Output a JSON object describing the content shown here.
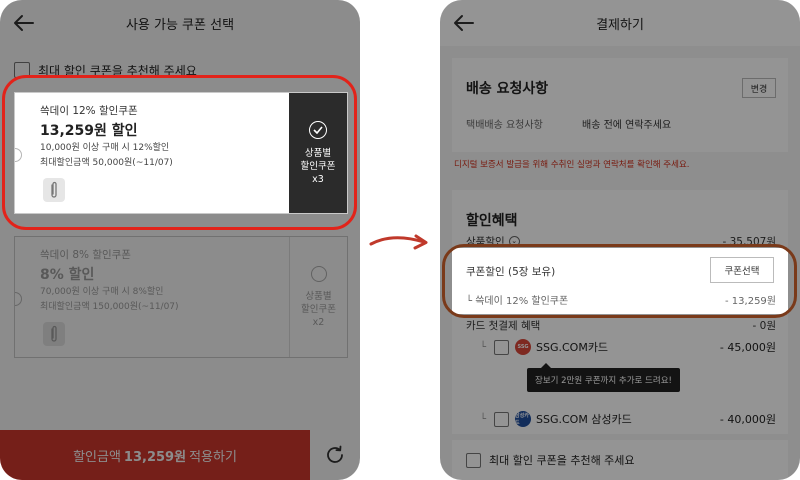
{
  "left": {
    "title": "사용 가능 쿠폰 선택",
    "recommend_label": "최대 할인 쿠폰을 추천해 주세요",
    "coupons": [
      {
        "name": "쓱데이 12% 할인쿠폰",
        "amount": "13,259원 할인",
        "cond1": "10,000원 이상 구매 시 12%할인",
        "cond2": "최대할인금액 50,000원(~11/07)",
        "side": "상품별\n할인쿠폰\nx3",
        "selected": true
      },
      {
        "name": "쓱데이 8% 할인쿠폰",
        "amount": "8% 할인",
        "cond1": "70,000원 이상 구매 시 8%할인",
        "cond2": "최대할인금액 150,000원(~11/07)",
        "side": "상품별\n할인쿠폰\nx2",
        "selected": false
      }
    ],
    "apply_prefix": "할인금액",
    "apply_amount": "13,259원",
    "apply_suffix": "적용하기"
  },
  "right": {
    "title": "결제하기",
    "shipping": {
      "title": "배송 요청사항",
      "change": "변경",
      "label": "택배배송 요청사항",
      "value": "배송 전에 연락주세요"
    },
    "notice": "디지털 보증서 발급을 위해 수취인 실명과 연락처를 확인해 주세요.",
    "discount": {
      "title": "할인혜택",
      "product_label": "상품할인",
      "product_value": "- 35,507원",
      "coupon_label": "쿠폰할인 (5장 보유)",
      "coupon_button": "쿠폰선택",
      "coupon_sub_label": "└ 쓱데이 12% 할인쿠폰",
      "coupon_sub_value": "- 13,259원",
      "card_label": "카드 첫결제 혜택",
      "card_value": "- 0원",
      "cards": [
        {
          "logo": "SSG",
          "name": "SSG.COM카드",
          "value": "- 45,000원",
          "color": "#d9473a"
        },
        {
          "logo": "삼성카드",
          "name": "SSG.COM 삼성카드",
          "value": "- 40,000원",
          "color": "#1f4e9e"
        }
      ],
      "tooltip": "장보기 2만원 쿠폰까지 추가로 드려요!"
    },
    "recommend_label": "최대 할인 쿠폰을 추천해 주세요"
  },
  "colors": {
    "highlight_left": "#e2231a",
    "highlight_right": "#7a3a1a",
    "apply_button": "#d63a2f",
    "notice_red": "#d0321f"
  },
  "icons": [
    "back-arrow-icon",
    "check-circle-icon",
    "paperclip-icon",
    "refresh-icon",
    "info-icon",
    "flow-arrow-icon"
  ]
}
